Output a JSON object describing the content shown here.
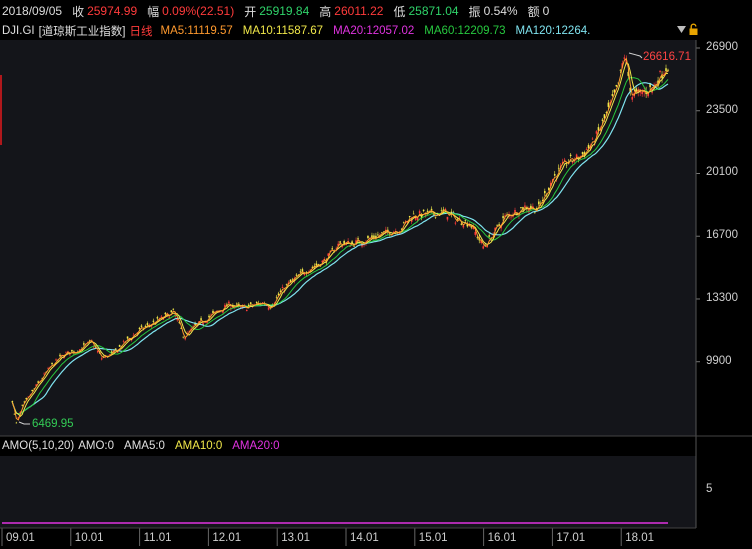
{
  "quote": {
    "date": "2018/09/05",
    "close_label": "收",
    "close": "25974.99",
    "change_label": "幅",
    "change": "0.09%(22.51)",
    "open_label": "开",
    "open": "25919.84",
    "high_label": "高",
    "high": "26011.22",
    "low_label": "低",
    "low": "25871.04",
    "amplitude_label": "振",
    "amplitude": "0.54%",
    "amount_label": "额",
    "amount": "0"
  },
  "chart": {
    "symbol": "DJI.GI",
    "name": "[道琼斯工业指数]",
    "period": "日线",
    "ma5": "MA5:11119.57",
    "ma10": "MA10:11587.67",
    "ma20": "MA20:12057.02",
    "ma60": "MA60:12209.73",
    "ma120": "MA120:12264.",
    "dropdown_icon": "triangle-down-icon",
    "lock_icon": "lock-icon"
  },
  "indicator": {
    "title": "AMO(5,10,20)",
    "amo": "AMO:0",
    "ama5": "AMA5:0",
    "ama10": "AMA10:0",
    "ama20": "AMA20:0",
    "y_tick": "5"
  },
  "colors": {
    "ma5": "#ff9a2e",
    "ma10": "#f2e94a",
    "ma20": "#e033e0",
    "ma60": "#27c93f",
    "ma120": "#7fe3ef",
    "up": "#ff3b3b",
    "down": "#2fd46a"
  },
  "chart_data": {
    "type": "line",
    "y_ticks": [
      "26900",
      "23500",
      "20100",
      "16700",
      "13300",
      "9900"
    ],
    "x_ticks": [
      "09.01",
      "10.01",
      "11.01",
      "12.01",
      "13.01",
      "14.01",
      "15.01",
      "16.01",
      "17.01",
      "18.01"
    ],
    "annotations": {
      "max": "26616.71",
      "min": "6469.95"
    },
    "ylim": [
      6200,
      26900
    ],
    "series": [
      {
        "x": [
          2009.15,
          2009.2,
          2009.3,
          2009.5,
          2009.7,
          2009.9,
          2010.1,
          2010.3,
          2010.45,
          2010.6,
          2010.8,
          2011.0,
          2011.3,
          2011.5,
          2011.65,
          2011.8,
          2012.0,
          2012.3,
          2012.5,
          2012.8,
          2012.9,
          2013.1,
          2013.4,
          2013.7,
          2013.9,
          2014.1,
          2014.3,
          2014.6,
          2014.8,
          2014.95,
          2015.2,
          2015.45,
          2015.6,
          2015.8,
          2016.0,
          2016.1,
          2016.3,
          2016.6,
          2016.8,
          2016.85,
          2017.0,
          2017.2,
          2017.4,
          2017.6,
          2017.8,
          2017.95,
          2018.05,
          2018.15,
          2018.3,
          2018.45,
          2018.6,
          2018.68
        ],
        "values": [
          7800,
          6470,
          7500,
          8600,
          9600,
          10300,
          10500,
          11000,
          10100,
          10300,
          11000,
          11600,
          12200,
          12600,
          11200,
          11800,
          12300,
          13000,
          12800,
          13100,
          12900,
          13900,
          14800,
          15400,
          16300,
          16300,
          16500,
          16900,
          17100,
          17800,
          17900,
          18000,
          17600,
          17400,
          16100,
          16600,
          17700,
          18300,
          18200,
          18600,
          19800,
          20700,
          21000,
          21800,
          23400,
          24800,
          26600,
          24300,
          24500,
          24700,
          25600,
          25975
        ]
      }
    ]
  }
}
